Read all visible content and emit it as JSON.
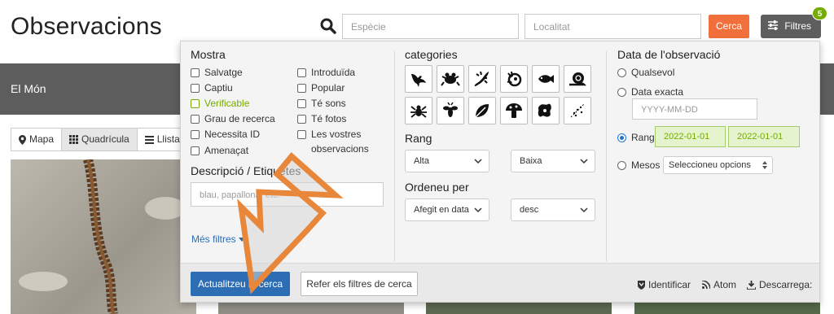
{
  "header": {
    "title": "Observacions",
    "species_placeholder": "Espècie",
    "location_placeholder": "Localitat",
    "search_button": "Cerca",
    "filters_button": "Filtres",
    "filters_count": "5"
  },
  "band": {
    "place": "El Món"
  },
  "view_tabs": [
    "Mapa",
    "Quadrícula",
    "Llista"
  ],
  "filters": {
    "show": {
      "heading": "Mostra",
      "left": [
        "Salvatge",
        "Captiu",
        "Verificable",
        "Grau de recerca",
        "Necessita ID",
        "Amenaçat"
      ],
      "right": [
        "Introduïda",
        "Popular",
        "Té sons",
        "Té fotos",
        "Les vostres",
        "observacions"
      ]
    },
    "description": {
      "heading": "Descripció / Etiquetes",
      "placeholder": "blau, papallona, etc.",
      "more_filters": "Més filtres"
    },
    "categories": {
      "heading": "categories"
    },
    "rank": {
      "heading": "Rang",
      "min": "Alta",
      "max": "Baixa"
    },
    "order": {
      "heading": "Ordeneu per",
      "by": "Afegit en data",
      "dir": "desc"
    },
    "date": {
      "heading": "Data de l'observació",
      "any": "Qualsevol",
      "exact": "Data exacta",
      "exact_placeholder": "YYYY-MM-DD",
      "range": "Rang",
      "range_from": "2022-01-01",
      "range_to": "2022-01-01",
      "months": "Mesos",
      "months_select": "Seleccioneu opcions"
    },
    "footer": {
      "update": "Actualitzeu la cerca",
      "reset": "Refer els filtres de cerca",
      "identify": "Identificar",
      "atom": "Atom",
      "download": "Descarrega:"
    }
  },
  "colors": {
    "accent_orange": "#f16f3a",
    "verified_green": "#74ac00",
    "primary_blue": "#2d6db4",
    "arrow": "#e8873a"
  }
}
